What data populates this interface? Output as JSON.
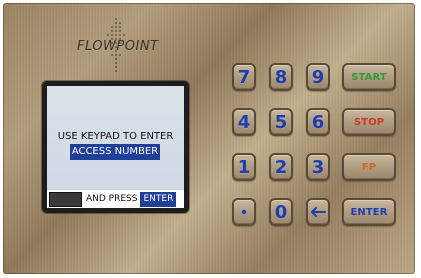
{
  "brand": {
    "logo_text": "FLOWPOINT"
  },
  "display": {
    "line1": "USE KEYPAD TO ENTER",
    "line2": "ACCESS NUMBER",
    "and_press": "AND PRESS",
    "enter_chip": "ENTER",
    "entry_value": ""
  },
  "keypad": {
    "keys": {
      "k7": "7",
      "k8": "8",
      "k9": "9",
      "k4": "4",
      "k5": "5",
      "k6": "6",
      "k1": "1",
      "k2": "2",
      "k3": "3",
      "k0": "0"
    },
    "dot_icon": "dot-icon",
    "back_icon": "left-arrow-icon"
  },
  "function_keys": {
    "start": "START",
    "stop": "STOP",
    "fp": "FP",
    "enter": "ENTER"
  },
  "colors": {
    "digit_blue": "#1f3fb0",
    "start_green": "#3a9a3d",
    "stop_red": "#c63b2f",
    "fp_orange": "#c56c2b",
    "screen_highlight": "#1f3f99"
  }
}
